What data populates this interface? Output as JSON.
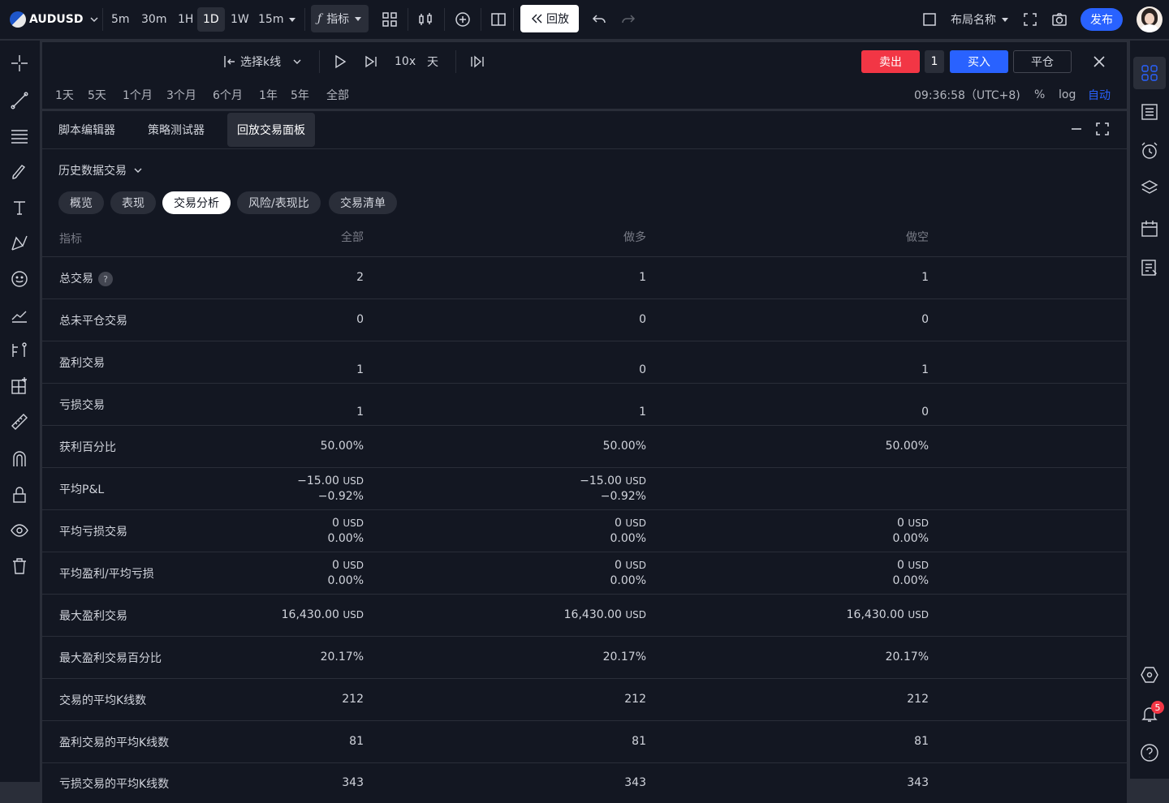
{
  "topbar": {
    "symbol": "AUDUSD",
    "intervals": [
      "5m",
      "30m",
      "1H",
      "1D",
      "1W",
      "15m"
    ],
    "indicators_label": "指标",
    "replay_label": "回放",
    "layout_name": "布局名称",
    "publish_label": "发布"
  },
  "replay": {
    "select_bar": "选择k线",
    "speed": "10x",
    "step": "天",
    "sell_label": "卖出",
    "quantity": "1",
    "buy_label": "买入",
    "close_label": "平仓"
  },
  "range": {
    "items": [
      "1天",
      "5天",
      "1个月",
      "3个月",
      "6个月",
      "1年",
      "5年",
      "全部"
    ],
    "time": "09:36:58（UTC+8)",
    "percent": "%",
    "log": "log",
    "auto": "自动"
  },
  "panel": {
    "tabs": [
      "脚本编辑器",
      "策略测试器",
      "回放交易面板"
    ],
    "dropdown": "历史数据交易",
    "subtabs": [
      "概览",
      "表现",
      "交易分析",
      "风险/表现比",
      "交易清单"
    ],
    "headers": [
      "指标",
      "全部",
      "做多",
      "做空"
    ],
    "rows": [
      {
        "label": "总交易",
        "all": "2",
        "long": "1",
        "short": "1"
      },
      {
        "label": "总未平仓交易",
        "all": "0",
        "long": "0",
        "short": "0"
      },
      {
        "label": "盈利交易",
        "all": "1",
        "long": "0",
        "short": "1"
      },
      {
        "label": "亏损交易",
        "all": "1",
        "long": "1",
        "short": "0"
      },
      {
        "label": "获利百分比",
        "all": "50.00%",
        "long": "50.00%",
        "short": "50.00%"
      },
      {
        "label": "平均P&L",
        "all": "−15.00",
        "all_unit": "USD",
        "all2": "−0.92%",
        "long": "−15.00",
        "long_unit": "USD",
        "long2": "−0.92%"
      },
      {
        "label": "平均亏损交易",
        "all": "0",
        "all_unit": "USD",
        "all2": "0.00%",
        "long": "0",
        "long_unit": "USD",
        "long2": "0.00%",
        "short": "0",
        "short_unit": "USD",
        "short2": "0.00%"
      },
      {
        "label": "平均盈利/平均亏损",
        "all": "0",
        "all_unit": "USD",
        "all2": "0.00%",
        "long": "0",
        "long_unit": "USD",
        "long2": "0.00%",
        "short": "0",
        "short_unit": "USD",
        "short2": "0.00%"
      },
      {
        "label": "最大盈利交易",
        "all": "16,430.00",
        "all_unit": "USD",
        "long": "16,430.00",
        "long_unit": "USD",
        "short": "16,430.00",
        "short_unit": "USD"
      },
      {
        "label": "最大盈利交易百分比",
        "all": "20.17%",
        "long": "20.17%",
        "short": "20.17%"
      },
      {
        "label": "交易的平均K线数",
        "all": "212",
        "long": "212",
        "short": "212"
      },
      {
        "label": "盈利交易的平均K线数",
        "all": "81",
        "long": "81",
        "short": "81"
      },
      {
        "label": "亏损交易的平均K线数",
        "all": "343",
        "long": "343",
        "short": "343"
      }
    ]
  },
  "notifications_count": "5",
  "colors": {
    "accent": "#2962ff",
    "sell": "#f23645",
    "background": "#131722"
  }
}
